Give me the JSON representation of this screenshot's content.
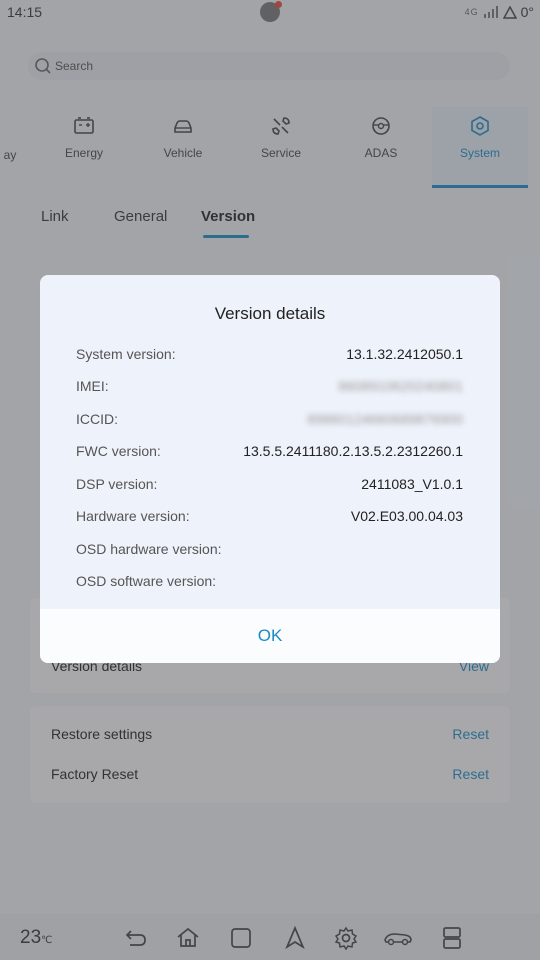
{
  "status_bar": {
    "time": "14:15",
    "network": "4G",
    "temp": "0°"
  },
  "search": {
    "placeholder": "Search"
  },
  "categories": [
    {
      "label": "ay"
    },
    {
      "label": "Energy",
      "icon": "battery-icon"
    },
    {
      "label": "Vehicle",
      "icon": "car-icon"
    },
    {
      "label": "Service",
      "icon": "wrench-icon"
    },
    {
      "label": "ADAS",
      "icon": "steering-icon"
    },
    {
      "label": "System",
      "icon": "hexagon-gear-icon",
      "active": true
    }
  ],
  "tabs": [
    {
      "label": "Link"
    },
    {
      "label": "General"
    },
    {
      "label": "Version",
      "active": true
    }
  ],
  "version_card": {
    "label": "Version details",
    "action": "View"
  },
  "reset_card": {
    "rows": [
      {
        "label": "Restore settings",
        "action": "Reset"
      },
      {
        "label": "Factory Reset",
        "action": "Reset"
      }
    ]
  },
  "nav_bar": {
    "temperature": "23",
    "unit": "℃"
  },
  "dialog": {
    "title": "Version details",
    "rows": [
      {
        "key": "System version:",
        "value": "13.1.32.2412050.1"
      },
      {
        "key": "IMEI:",
        "value": "8608910620240801",
        "obscured": true
      },
      {
        "key": "ICCID:",
        "value": "89860124660689876900",
        "obscured": true
      },
      {
        "key": "FWC version:",
        "value": "13.5.5.2411180.2.13.5.2.2312260.1"
      },
      {
        "key": "DSP version:",
        "value": "2411083_V1.0.1"
      },
      {
        "key": "Hardware version:",
        "value": "V02.E03.00.04.03"
      },
      {
        "key": "OSD hardware version:",
        "value": ""
      },
      {
        "key": "OSD software version:",
        "value": ""
      }
    ],
    "ok_label": "OK"
  },
  "colors": {
    "accent": "#1b8bc6",
    "dialog_bg": "#eef2fa",
    "scrim": "#46484c"
  }
}
